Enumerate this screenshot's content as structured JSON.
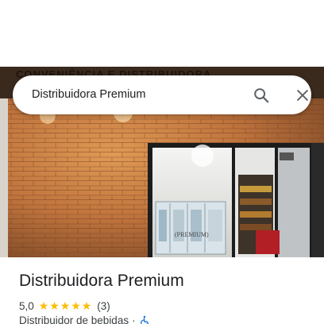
{
  "search": {
    "query": "Distribuidora Premium",
    "search_icon": "search-icon",
    "close_icon": "close-icon"
  },
  "photo": {
    "signage_text": "CONVENIÊNCIA E DISTRIBUIDORA",
    "door_logo_text": "PREMIUM"
  },
  "place": {
    "name": "Distribuidora Premium",
    "rating": "5,0",
    "stars": 5,
    "review_count": "(3)",
    "category": "Distribuidor de bebidas",
    "separator": "·",
    "accessibility_icon": "wheelchair-icon"
  },
  "colors": {
    "star": "#fbbc04",
    "accessibility": "#1a73e8",
    "text_primary": "#202124",
    "text_secondary": "#3c4043"
  }
}
